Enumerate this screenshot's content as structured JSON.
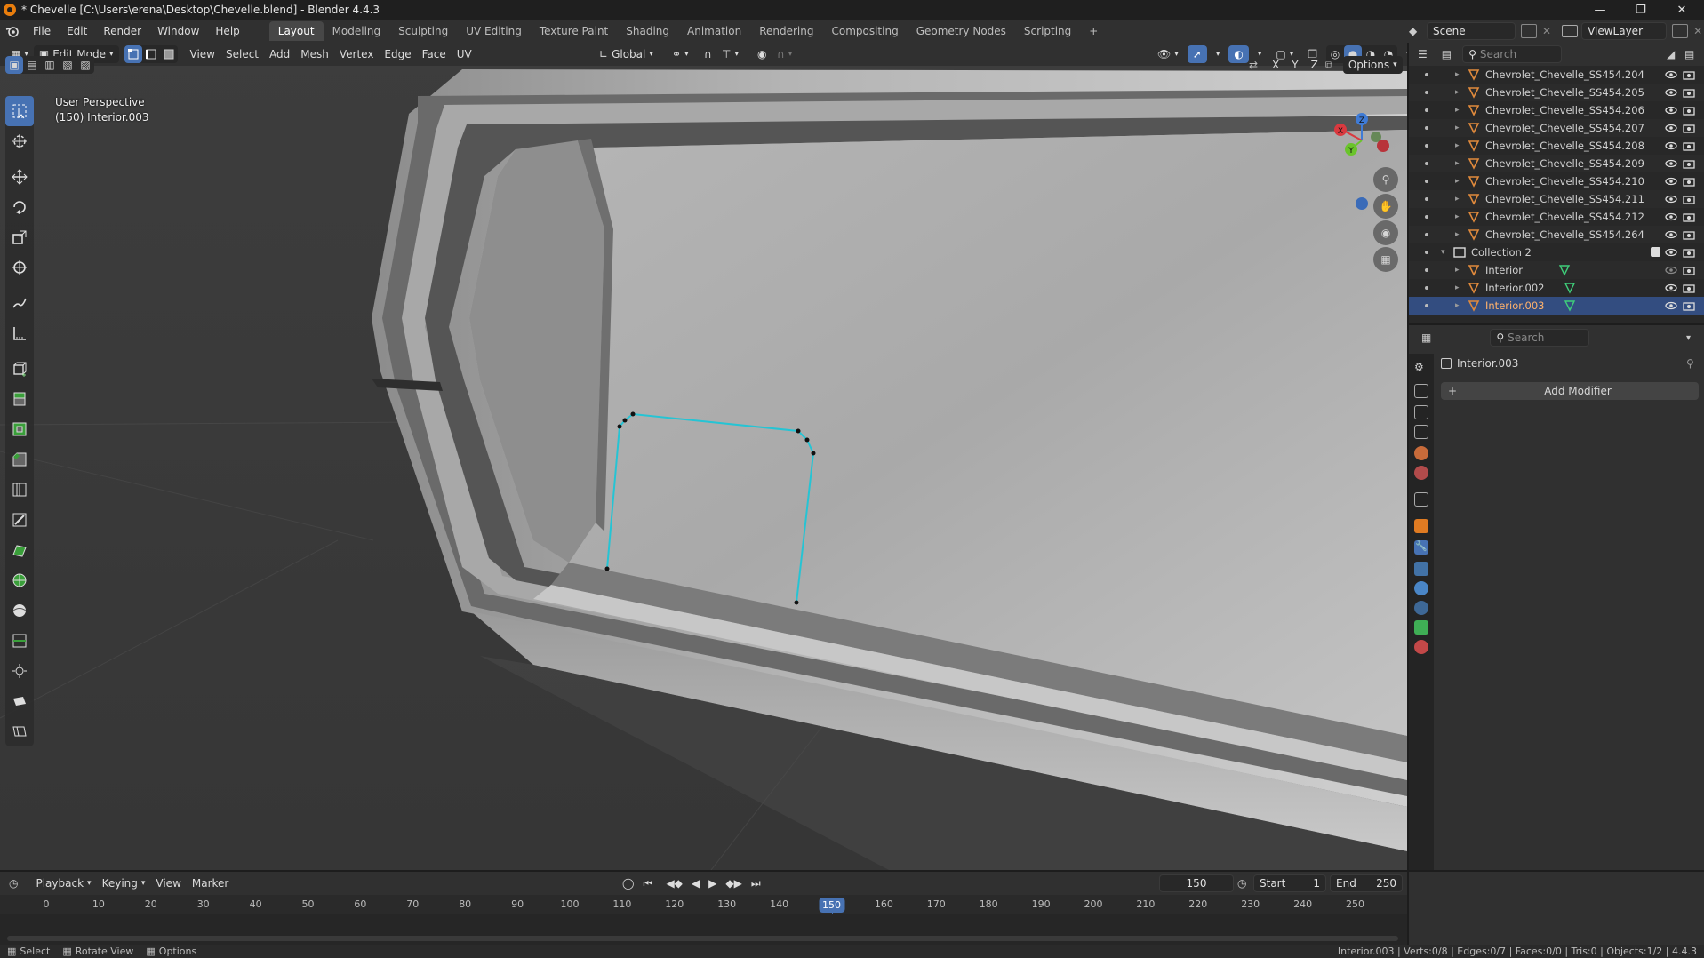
{
  "window": {
    "title": "* Chevelle [C:\\Users\\erena\\Desktop\\Chevelle.blend] - Blender 4.4.3",
    "controls": [
      "minimize",
      "maximize",
      "close"
    ]
  },
  "menu": [
    "File",
    "Edit",
    "Render",
    "Window",
    "Help"
  ],
  "workspaces": {
    "tabs": [
      "Layout",
      "Modeling",
      "Sculpting",
      "UV Editing",
      "Texture Paint",
      "Shading",
      "Animation",
      "Rendering",
      "Compositing",
      "Geometry Nodes",
      "Scripting"
    ],
    "active": "Layout",
    "add_label": "+"
  },
  "scene": {
    "label": "Scene",
    "view_layer": "ViewLayer"
  },
  "viewport": {
    "mode": "Edit Mode",
    "menus": [
      "View",
      "Select",
      "Add",
      "Mesh",
      "Vertex",
      "Edge",
      "Face",
      "UV"
    ],
    "transform_orientation": "Global",
    "axes": [
      "X",
      "Y",
      "Z"
    ],
    "options_label": "Options",
    "overlay_line1": "User Perspective",
    "overlay_line2": "(150) Interior.003",
    "gizmo_axes": {
      "x": "X",
      "y": "Y",
      "z": "Z"
    },
    "colors": {
      "selection_edge": "#25c4d4",
      "x_axis": "#d9393f",
      "y_axis": "#6ac42b",
      "z_axis": "#3f7bd6"
    }
  },
  "tools": [
    "select-box",
    "cursor",
    "move",
    "rotate",
    "scale",
    "transform",
    "annotate",
    "measure",
    "add-cube",
    "extrude",
    "inset",
    "bevel",
    "loop-cut",
    "knife",
    "poly-build",
    "spin",
    "smooth",
    "edge-slide",
    "shrink-fatten",
    "shear",
    "rip"
  ],
  "outliner": {
    "search_placeholder": "Search",
    "rows": [
      {
        "label": "Chevrolet_Chevelle_SS454.204",
        "indent": 2
      },
      {
        "label": "Chevrolet_Chevelle_SS454.205",
        "indent": 2
      },
      {
        "label": "Chevrolet_Chevelle_SS454.206",
        "indent": 2
      },
      {
        "label": "Chevrolet_Chevelle_SS454.207",
        "indent": 2
      },
      {
        "label": "Chevrolet_Chevelle_SS454.208",
        "indent": 2
      },
      {
        "label": "Chevrolet_Chevelle_SS454.209",
        "indent": 2
      },
      {
        "label": "Chevrolet_Chevelle_SS454.210",
        "indent": 2
      },
      {
        "label": "Chevrolet_Chevelle_SS454.211",
        "indent": 2
      },
      {
        "label": "Chevrolet_Chevelle_SS454.212",
        "indent": 2
      },
      {
        "label": "Chevrolet_Chevelle_SS454.264",
        "indent": 2
      },
      {
        "label": "Collection 2",
        "indent": 1,
        "type": "collection"
      },
      {
        "label": "Interior",
        "indent": 2
      },
      {
        "label": "Interior.002",
        "indent": 2
      },
      {
        "label": "Interior.003",
        "indent": 2,
        "selected": true
      }
    ]
  },
  "properties": {
    "search_placeholder": "Search",
    "object_name": "Interior.003",
    "add_modifier": "Add Modifier"
  },
  "timeline": {
    "menus": [
      "Playback",
      "Keying",
      "View",
      "Marker"
    ],
    "current_frame": "150",
    "start_label": "Start",
    "start": "1",
    "end_label": "End",
    "end": "250",
    "ticks": [
      "0",
      "10",
      "20",
      "30",
      "40",
      "50",
      "60",
      "70",
      "80",
      "90",
      "100",
      "110",
      "120",
      "130",
      "140",
      "150",
      "160",
      "170",
      "180",
      "190",
      "200",
      "210",
      "220",
      "230",
      "240",
      "250"
    ]
  },
  "statusbar": {
    "left": [
      "Select",
      "Rotate View",
      "Options"
    ],
    "right": "Interior.003 | Verts:0/8 | Edges:0/7 | Faces:0/0 | Tris:0 | Objects:1/2 | 4.4.3"
  }
}
